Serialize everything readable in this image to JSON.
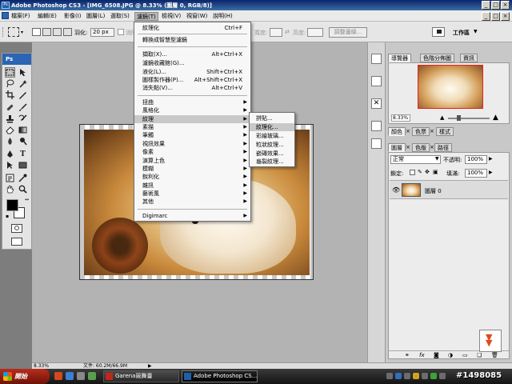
{
  "window": {
    "app_icon": "Ps",
    "title": "Adobe Photoshop CS3 - [IMG_6508.JPG @ 8.33% (圖層 0, RGB/8)]",
    "controls": [
      "_",
      "□",
      "×"
    ]
  },
  "menubar": {
    "items": [
      "檔案(F)",
      "編輯(E)",
      "影像(I)",
      "圖層(L)",
      "選取(S)",
      "濾鏡(T)",
      "檢視(V)",
      "視窗(W)",
      "說明(H)"
    ],
    "active_index": 5,
    "doc_controls": [
      "_",
      "□",
      "×"
    ]
  },
  "optionsbar": {
    "feather_label": "羽化:",
    "feather_value": "20 px",
    "antialias_label": "消除",
    "width_label": "寬度:",
    "height_label": "高度:",
    "refine_edge_label": "調整邊緣...",
    "workspace_label": "工作區"
  },
  "toolbox": {
    "logo": "Ps",
    "colors": {
      "foreground": "#000000",
      "background": "#ffffff"
    }
  },
  "filter_menu": {
    "items": [
      {
        "label": "紋理化",
        "shortcut": "Ctrl+F"
      },
      {
        "sep": true
      },
      {
        "label": "轉換成智慧型濾鏡"
      },
      {
        "sep": true
      },
      {
        "label": "擷取(X)...",
        "shortcut": "Alt+Ctrl+X"
      },
      {
        "label": "濾鏡收藏館(G)..."
      },
      {
        "label": "液化(L)...",
        "shortcut": "Shift+Ctrl+X"
      },
      {
        "label": "圖樣製作器(P)...",
        "shortcut": "Alt+Shift+Ctrl+X"
      },
      {
        "label": "消失點(V)...",
        "shortcut": "Alt+Ctrl+V"
      },
      {
        "sep": true
      },
      {
        "label": "扭曲",
        "submenu": true
      },
      {
        "label": "風格化",
        "submenu": true
      },
      {
        "label": "紋理",
        "submenu": true,
        "highlighted": true
      },
      {
        "label": "素描",
        "submenu": true
      },
      {
        "label": "筆觸",
        "submenu": true
      },
      {
        "label": "視訊效果",
        "submenu": true
      },
      {
        "label": "像素",
        "submenu": true
      },
      {
        "label": "演算上色",
        "submenu": true
      },
      {
        "label": "模糊",
        "submenu": true
      },
      {
        "label": "銳利化",
        "submenu": true
      },
      {
        "label": "雜訊",
        "submenu": true
      },
      {
        "label": "藝術風",
        "submenu": true
      },
      {
        "label": "其他",
        "submenu": true
      },
      {
        "sep": true
      },
      {
        "label": "Digimarc",
        "submenu": true
      }
    ]
  },
  "texture_submenu": {
    "items": [
      {
        "label": "拼貼..."
      },
      {
        "label": "紋理化...",
        "highlighted": true
      },
      {
        "label": "彩繪玻璃..."
      },
      {
        "label": "粒狀紋理..."
      },
      {
        "label": "嵌磚效果..."
      },
      {
        "label": "龜裂紋理..."
      }
    ]
  },
  "navigator_panel": {
    "tabs": [
      "導覽器",
      "色階分佈圖",
      "資訊"
    ],
    "zoom_value": "8.33%"
  },
  "color_panel": {
    "tabs": [
      "顏色",
      "色票",
      "樣式"
    ]
  },
  "layers_panel": {
    "tabs": [
      "圖層",
      "色版",
      "路徑"
    ],
    "blend_mode": "正常",
    "opacity_label": "不透明:",
    "opacity_value": "100%",
    "lock_label": "鎖定:",
    "fill_label": "填滿:",
    "fill_value": "100%",
    "layers": [
      {
        "name": "圖層 0"
      }
    ],
    "footer_icons": [
      "link-icon",
      "fx-icon",
      "mask-icon",
      "adjustment-icon",
      "folder-icon",
      "new-layer-icon",
      "trash-icon"
    ]
  },
  "statusbar": {
    "zoom": "8.33%",
    "doc_info": "文件: 60.2M/66.9M"
  },
  "taskbar": {
    "start_label": "開始",
    "tasks": [
      {
        "label": "Garena競舞臺",
        "active": false
      },
      {
        "label": "Adobe Photoshop CS...",
        "active": true
      }
    ],
    "watermark": "#1498085"
  }
}
